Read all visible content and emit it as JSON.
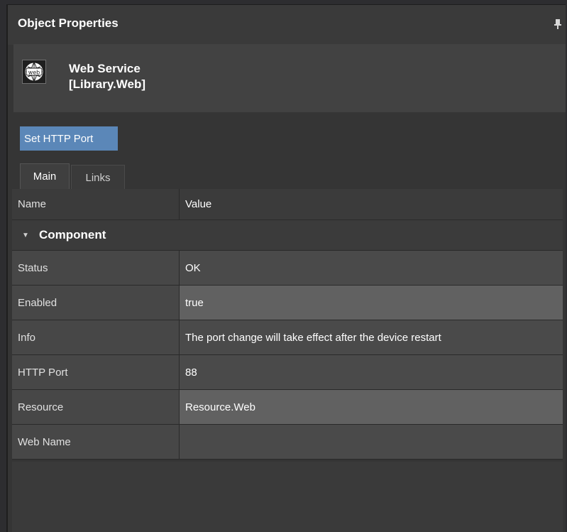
{
  "panel": {
    "title": "Object Properties",
    "pin_icon": "pin-icon"
  },
  "object": {
    "icon": "web-globe-icon",
    "icon_text": "web",
    "name": "Web Service",
    "type": "[Library.Web]"
  },
  "actions": {
    "set_http_port": "Set HTTP Port"
  },
  "tabs": [
    {
      "label": "Main",
      "active": true
    },
    {
      "label": "Links",
      "active": false
    }
  ],
  "grid": {
    "header": {
      "name": "Name",
      "value": "Value"
    },
    "group": "Component",
    "rows": [
      {
        "name": "Status",
        "value": "OK"
      },
      {
        "name": "Enabled",
        "value": "true"
      },
      {
        "name": "Info",
        "value": "The port change will take effect after the device restart"
      },
      {
        "name": "HTTP Port",
        "value": "88"
      },
      {
        "name": "Resource",
        "value": "Resource.Web"
      },
      {
        "name": "Web Name",
        "value": ""
      }
    ]
  },
  "colors": {
    "button_accent": "#5b87b8",
    "panel_bg": "#353535"
  }
}
